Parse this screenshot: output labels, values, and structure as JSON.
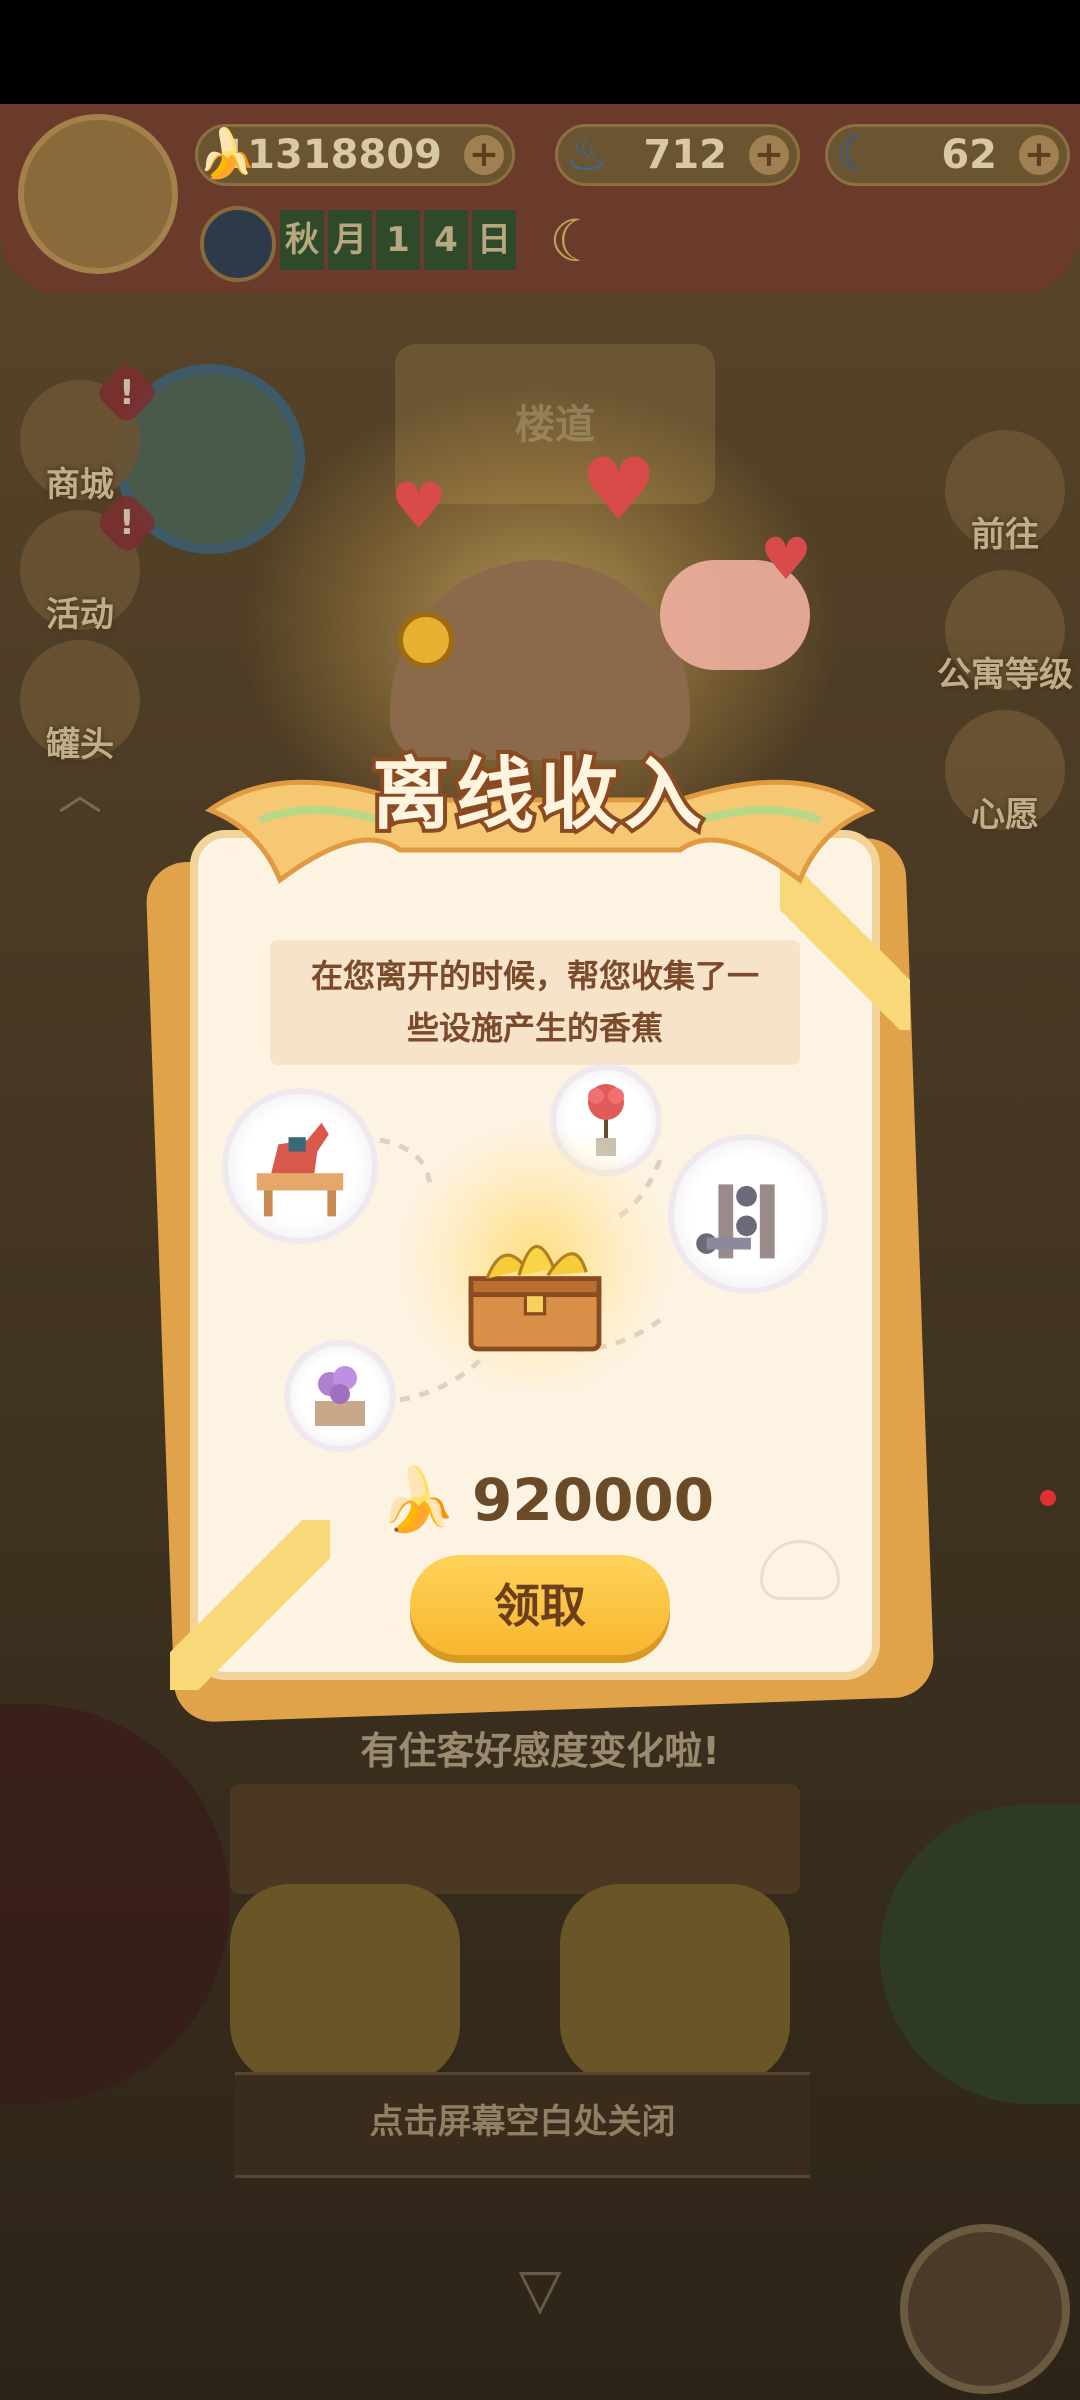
{
  "resources": [
    {
      "icon": "banana-icon",
      "value": "11318809"
    },
    {
      "icon": "flame-icon",
      "value": "712"
    },
    {
      "icon": "blue-banana-icon",
      "value": "62"
    }
  ],
  "date": {
    "chars": [
      "秋",
      "月",
      "1",
      "4",
      "日"
    ]
  },
  "left_menu": [
    {
      "label": "商城",
      "badge": "!"
    },
    {
      "label": "活动",
      "badge": "!"
    },
    {
      "label": "罐头",
      "badge": ""
    }
  ],
  "right_menu": [
    {
      "label": "前往"
    },
    {
      "label": "公寓等级"
    },
    {
      "label": "心愿"
    }
  ],
  "location_sign": "楼道",
  "dialog": {
    "title": "离线收入",
    "message_line1": "在您离开的时候，帮您收集了一",
    "message_line2": "些设施产生的香蕉",
    "amount": "920000",
    "claim_label": "领取"
  },
  "favor_text": "有住客好感度变化啦!",
  "close_hint": "点击屏幕空白处关闭",
  "colors": {
    "accent": "#f8b62e",
    "title_stroke": "#8a4a22",
    "card_bg": "#fdf3e3"
  }
}
